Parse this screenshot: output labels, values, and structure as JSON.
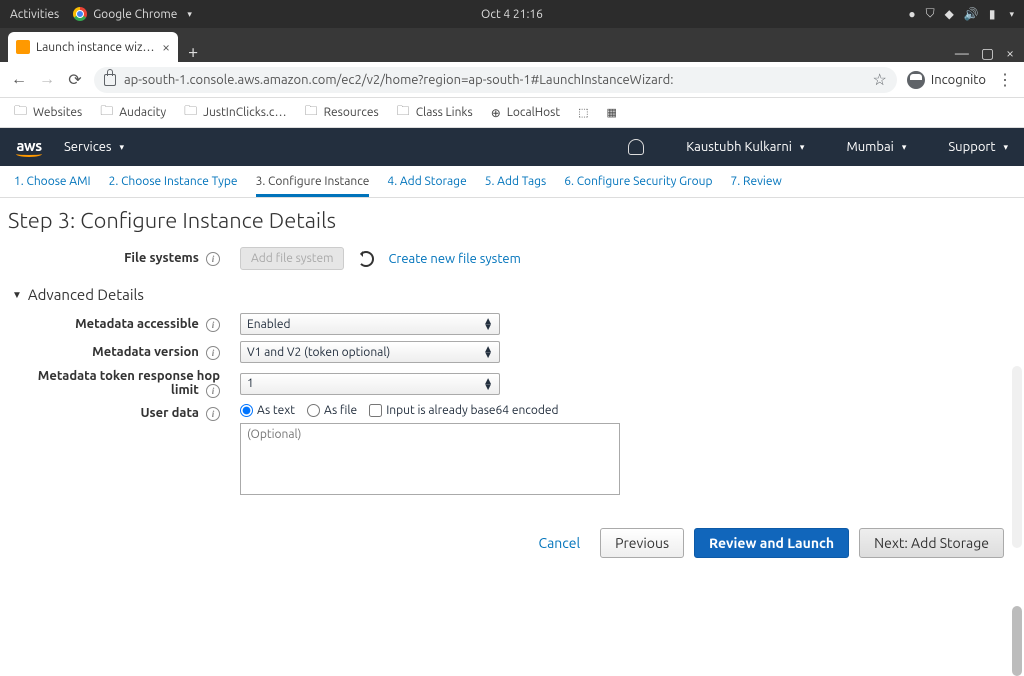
{
  "gnome": {
    "activities": "Activities",
    "app": "Google Chrome",
    "clock": "Oct 4  21:16"
  },
  "chrome": {
    "tab_title": "Launch instance wizard |",
    "url": "ap-south-1.console.aws.amazon.com/ec2/v2/home?region=ap-south-1#LaunchInstanceWizard:",
    "incognito": "Incognito",
    "bookmarks": [
      "Websites",
      "Audacity",
      "JustInClicks.c…",
      "Resources",
      "Class Links",
      "LocalHost"
    ]
  },
  "aws": {
    "services": "Services",
    "user": "Kaustubh Kulkarni",
    "region": "Mumbai",
    "support": "Support"
  },
  "wizard": {
    "tabs": [
      "1. Choose AMI",
      "2. Choose Instance Type",
      "3. Configure Instance",
      "4. Add Storage",
      "5. Add Tags",
      "6. Configure Security Group",
      "7. Review"
    ],
    "active_index": 2
  },
  "page": {
    "title": "Step 3: Configure Instance Details",
    "file_systems_label": "File systems",
    "add_fs_btn": "Add file system",
    "create_fs_link": "Create new file system",
    "adv_header": "Advanced Details",
    "rows": {
      "metadata_accessible": {
        "label": "Metadata accessible",
        "value": "Enabled"
      },
      "metadata_version": {
        "label": "Metadata version",
        "value": "V1 and V2 (token optional)"
      },
      "hop_limit": {
        "label": "Metadata token response hop limit",
        "value": "1"
      },
      "user_data": {
        "label": "User data",
        "as_text": "As text",
        "as_file": "As file",
        "base64": "Input is already base64 encoded",
        "placeholder": "(Optional)"
      }
    }
  },
  "footer": {
    "cancel": "Cancel",
    "previous": "Previous",
    "review": "Review and Launch",
    "next": "Next: Add Storage"
  }
}
